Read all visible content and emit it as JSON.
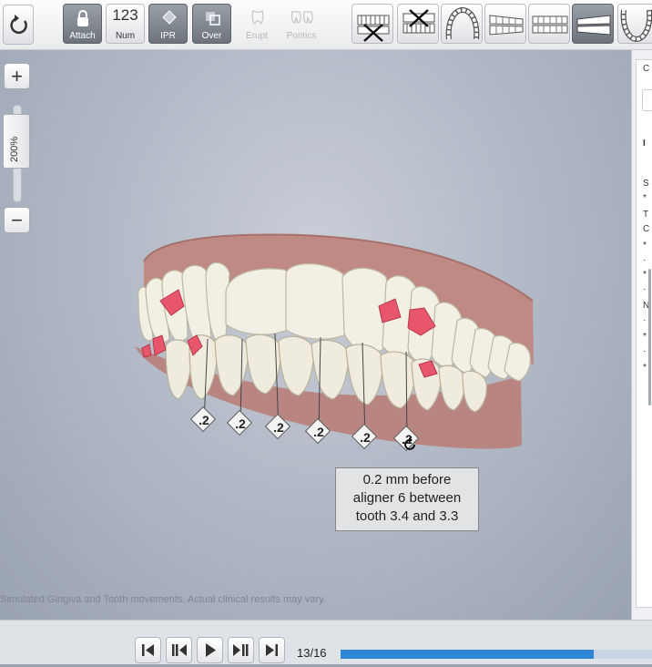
{
  "toolbar": {
    "attach_label": "Attach",
    "num_top": "123",
    "num_label": "Num",
    "ipr_label": "IPR",
    "over_label": "Over",
    "erupt_label": "Erupt",
    "pontics_label": "Pontics"
  },
  "zoom": {
    "value": "200%",
    "plus": "+",
    "minus": "−"
  },
  "ipr_markers": [
    ".2",
    ".2",
    ".2",
    ".2",
    ".2",
    ".2"
  ],
  "tooltip": {
    "line1": "0.2 mm before",
    "line2": "aligner 6 between",
    "line3": "tooth 3.4 and 3.3"
  },
  "disclaimer": "Simulated Gingiva and Tooth movements.  Actual clinical results may vary.",
  "right_panel": {
    "glyphs": [
      "C",
      "I",
      "S",
      "*",
      "T",
      "C",
      "*",
      "·",
      "*",
      "·",
      "N",
      "·",
      "*",
      "·",
      "*"
    ]
  },
  "playback": {
    "counter": "13/16",
    "progress": 0.8125
  },
  "colors": {
    "accent": "#2f86d6",
    "attachment": "#e8566b",
    "gingiva": "#b77d78",
    "tooth": "#f1eee2"
  }
}
